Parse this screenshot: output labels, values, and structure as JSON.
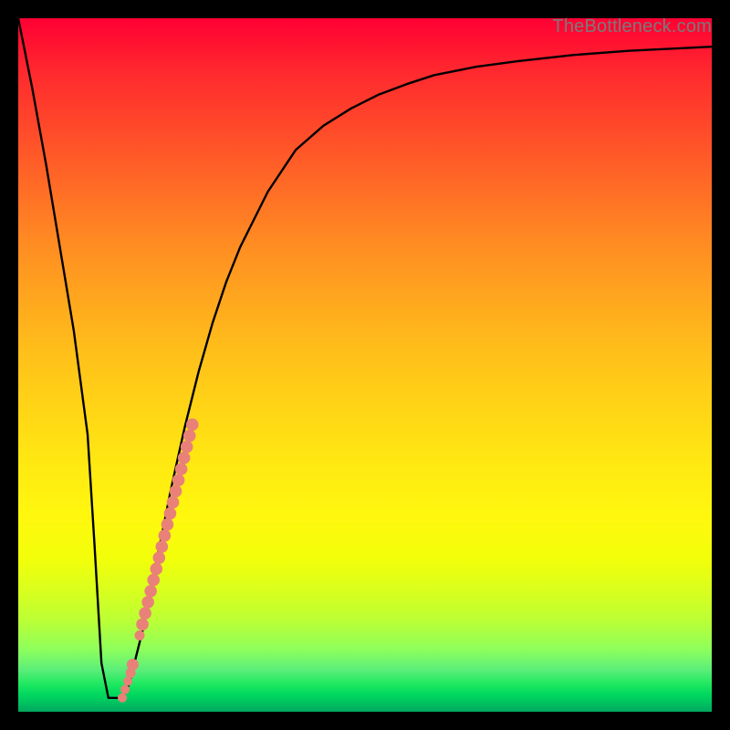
{
  "watermark": "TheBottleneck.com",
  "colors": {
    "frame": "#000000",
    "curve_stroke": "#000000",
    "dot_fill": "#e98179",
    "gradient_top": "#ff0033",
    "gradient_bottom": "#00a85f"
  },
  "chart_data": {
    "type": "line",
    "title": "",
    "xlabel": "",
    "ylabel": "",
    "xlim": [
      0,
      100
    ],
    "ylim": [
      0,
      100
    ],
    "grid": false,
    "curve": {
      "x": [
        0,
        2,
        4,
        6,
        8,
        10,
        11,
        12,
        13,
        14,
        15,
        16,
        18,
        20,
        22,
        24,
        26,
        28,
        30,
        32,
        34,
        36,
        38,
        40,
        44,
        48,
        52,
        56,
        60,
        66,
        72,
        80,
        88,
        96,
        100
      ],
      "y": [
        100,
        90,
        79,
        67,
        55,
        40,
        24,
        7,
        2,
        2,
        2,
        4,
        12,
        22,
        32,
        41,
        49,
        56,
        62,
        67,
        71,
        75,
        78,
        81,
        84.5,
        87,
        89,
        90.5,
        91.8,
        93,
        93.8,
        94.7,
        95.3,
        95.7,
        95.9
      ]
    },
    "dots": {
      "x": [
        15.0,
        15.4,
        15.8,
        16.2,
        16.5,
        17.5,
        17.9,
        18.3,
        18.7,
        19.1,
        19.5,
        19.9,
        20.3,
        20.7,
        21.1,
        21.5,
        21.9,
        22.3,
        22.7,
        23.1,
        23.5,
        23.9,
        24.3,
        24.7,
        25.1
      ],
      "y": [
        2.0,
        3.2,
        4.4,
        5.6,
        6.8,
        11.0,
        12.6,
        14.2,
        15.8,
        17.4,
        19.0,
        20.6,
        22.2,
        23.8,
        25.4,
        27.0,
        28.6,
        30.2,
        31.8,
        33.4,
        35.0,
        36.6,
        38.2,
        39.8,
        41.4
      ],
      "r": [
        5.0,
        5.0,
        5.0,
        5.5,
        6.5,
        5.5,
        6.8,
        6.8,
        6.8,
        6.8,
        6.8,
        6.8,
        6.8,
        6.8,
        6.8,
        6.8,
        6.8,
        6.8,
        6.8,
        6.8,
        6.8,
        6.8,
        6.8,
        6.8,
        6.8
      ]
    }
  }
}
